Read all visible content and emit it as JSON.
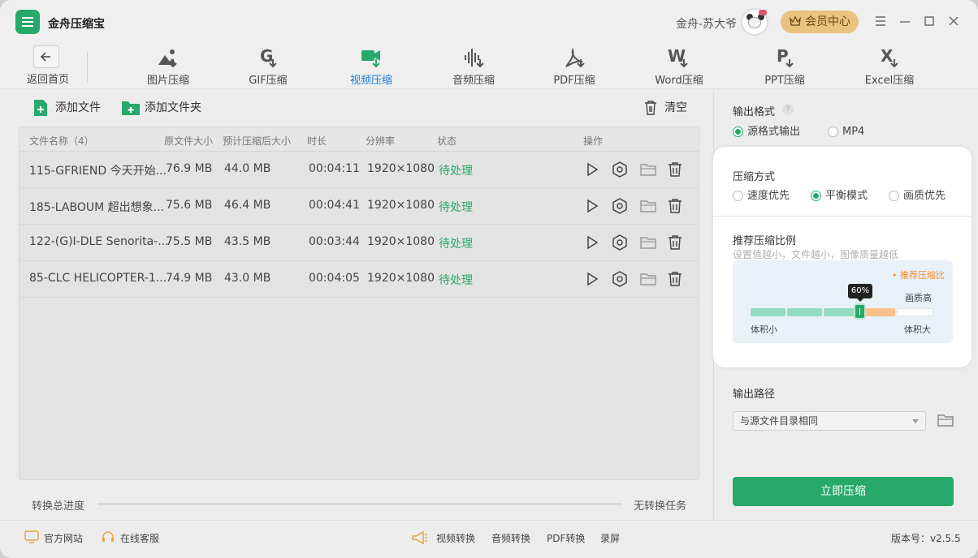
{
  "app": {
    "name": "金舟压缩宝",
    "version": "版本号：v2.5.5"
  },
  "user": {
    "name": "金舟-苏大爷",
    "vip_label": "会员中心"
  },
  "toolbar": {
    "back_label": "返回首页",
    "tools": [
      {
        "label": "图片压缩",
        "icon": "image-compress-icon",
        "active": false
      },
      {
        "label": "GIF压缩",
        "icon": "gif-compress-icon",
        "active": false
      },
      {
        "label": "视频压缩",
        "icon": "video-compress-icon",
        "active": true
      },
      {
        "label": "音频压缩",
        "icon": "audio-compress-icon",
        "active": false
      },
      {
        "label": "PDF压缩",
        "icon": "pdf-compress-icon",
        "active": false
      },
      {
        "label": "Word压缩",
        "icon": "word-compress-icon",
        "active": false
      },
      {
        "label": "PPT压缩",
        "icon": "ppt-compress-icon",
        "active": false
      },
      {
        "label": "Excel压缩",
        "icon": "excel-compress-icon",
        "active": false
      }
    ]
  },
  "actions": {
    "add_file": "添加文件",
    "add_folder": "添加文件夹",
    "clear": "清空"
  },
  "table": {
    "headers": {
      "name": "文件名称（4）",
      "orig_size": "原文件大小",
      "est_size": "预计压缩后大小",
      "duration": "时长",
      "resolution": "分辨率",
      "status": "状态",
      "ops": "操作"
    },
    "rows": [
      {
        "name": "115-GFRIEND 今天开始...",
        "orig_size": "76.9 MB",
        "est_size": "44.0 MB",
        "duration": "00:04:11",
        "resolution": "1920×1080",
        "status": "待处理"
      },
      {
        "name": "185-LABOUM 超出想象...",
        "orig_size": "75.6 MB",
        "est_size": "46.4 MB",
        "duration": "00:04:41",
        "resolution": "1920×1080",
        "status": "待处理"
      },
      {
        "name": "122-(G)I-DLE Senorita-...",
        "orig_size": "75.5 MB",
        "est_size": "43.5 MB",
        "duration": "00:03:44",
        "resolution": "1920×1080",
        "status": "待处理"
      },
      {
        "name": "85-CLC HELICOPTER-1...",
        "orig_size": "74.9 MB",
        "est_size": "43.0 MB",
        "duration": "00:04:05",
        "resolution": "1920×1080",
        "status": "待处理"
      }
    ]
  },
  "progress": {
    "label": "转换总进度",
    "status": "无转换任务",
    "value": 0
  },
  "output_format": {
    "title": "输出格式",
    "help": "?",
    "options": [
      "源格式输出",
      "MP4"
    ],
    "selected": 0
  },
  "compress_mode": {
    "title": "压缩方式",
    "options": [
      "速度优先",
      "平衡模式",
      "画质优先"
    ],
    "selected": 1
  },
  "ratio": {
    "title": "推荐压缩比例",
    "hint": "设置值越小，文件越小，图像质量越低",
    "recommended_label": "• 推荐压缩比",
    "high_quality_label": "画质高",
    "small_label": "体积小",
    "large_label": "体积大",
    "value": 60,
    "value_label": "60%"
  },
  "output_path": {
    "title": "输出路径",
    "value": "与源文件目录相同"
  },
  "start_button": "立即压缩",
  "statusbar": {
    "official_site": "官方网站",
    "support": "在线客服",
    "links": [
      "视频转换",
      "音频转换",
      "PDF转换",
      "录屏"
    ]
  },
  "colors": {
    "accent": "#27a96a",
    "active_tab": "#1f7cd2",
    "recommend": "#ef8c2c",
    "vip": "#e9c27d"
  }
}
